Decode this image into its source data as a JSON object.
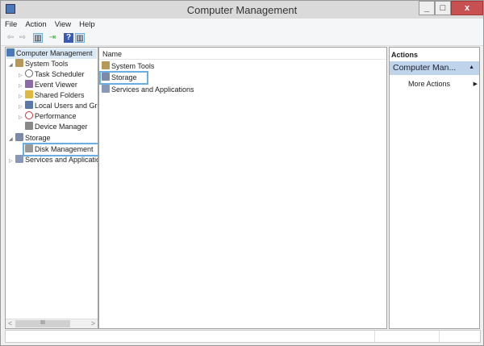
{
  "window": {
    "title": "Computer Management",
    "minimize": "_",
    "maximize": "□",
    "close": "x"
  },
  "menu": [
    "File",
    "Action",
    "View",
    "Help"
  ],
  "toolbar": {
    "icons": [
      "back-icon",
      "forward-icon",
      "console-tree-icon",
      "export-icon",
      "help-icon",
      "show-hide-icon"
    ]
  },
  "tree": {
    "root": "Computer Management",
    "items": [
      {
        "label": "System Tools",
        "level": 1,
        "expander": "◢"
      },
      {
        "label": "Task Scheduler",
        "level": 2,
        "expander": "▷"
      },
      {
        "label": "Event Viewer",
        "level": 2,
        "expander": "▷"
      },
      {
        "label": "Shared Folders",
        "level": 2,
        "expander": "▷"
      },
      {
        "label": "Local Users and Groups",
        "level": 2,
        "expander": "▷"
      },
      {
        "label": "Performance",
        "level": 2,
        "expander": "▷"
      },
      {
        "label": "Device Manager",
        "level": 2,
        "expander": ""
      },
      {
        "label": "Storage",
        "level": 1,
        "expander": "◢"
      },
      {
        "label": "Disk Management",
        "level": 2,
        "expander": ""
      },
      {
        "label": "Services and Applications",
        "level": 1,
        "expander": "▷"
      }
    ],
    "scroll_thumb": "III",
    "scroll_left": "<",
    "scroll_right": ">"
  },
  "list": {
    "header": "Name",
    "items": [
      "System Tools",
      "Storage",
      "Services and Applications"
    ]
  },
  "actions": {
    "header": "Actions",
    "section": "Computer Man...",
    "collapse": "▲",
    "more": "More Actions",
    "more_arrow": "▶"
  },
  "colors": {
    "selection": "#6aaee6",
    "actions_section": "#bfd3ea"
  }
}
